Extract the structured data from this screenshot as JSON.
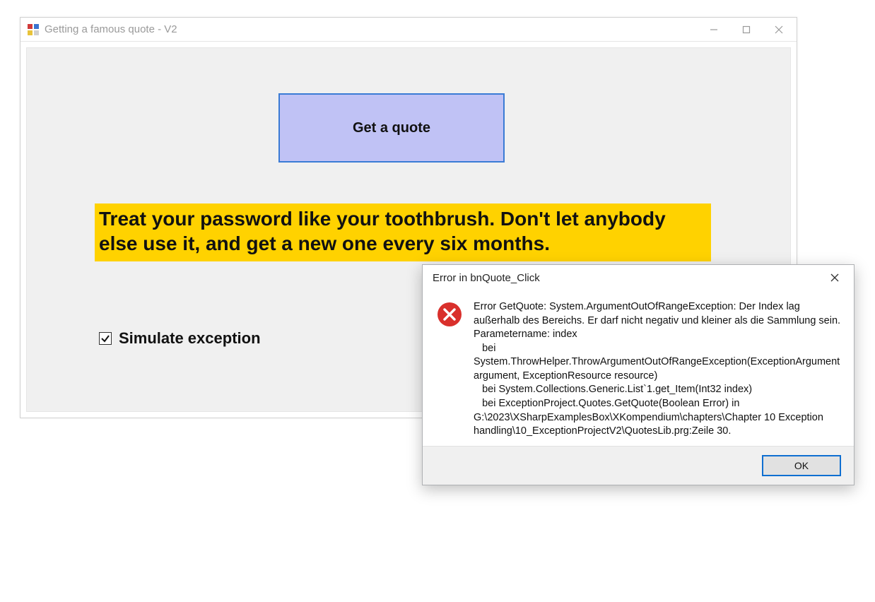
{
  "mainWindow": {
    "title": "Getting a famous quote - V2",
    "getQuoteButton": "Get a quote",
    "quoteText": "Treat your password like your toothbrush. Don't let anybody else use it, and get a new one every six months.",
    "simulateExceptionLabel": "Simulate exception",
    "simulateExceptionChecked": true
  },
  "errorDialog": {
    "title": "Error in bnQuote_Click",
    "message": "Error GetQuote: System.ArgumentOutOfRangeException: Der Index lag außerhalb des Bereichs. Er darf nicht negativ und kleiner als die Sammlung sein.\nParametername: index\n   bei System.ThrowHelper.ThrowArgumentOutOfRangeException(ExceptionArgument argument, ExceptionResource resource)\n   bei System.Collections.Generic.List`1.get_Item(Int32 index)\n   bei ExceptionProject.Quotes.GetQuote(Boolean Error) in G:\\2023\\XSharpExamplesBox\\XKompendium\\chapters\\Chapter 10 Exception handling\\10_ExceptionProjectV2\\QuotesLib.prg:Zeile 30.",
    "okButton": "OK"
  }
}
